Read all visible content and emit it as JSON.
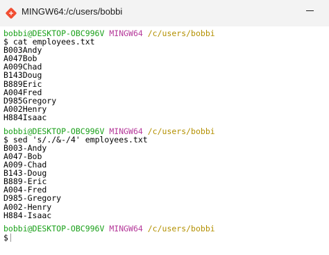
{
  "window": {
    "title": "MINGW64:/c/users/bobbi",
    "app_icon": "git-bash-icon"
  },
  "colors": {
    "user_host": "#1aa01a",
    "shell_name": "#b5399a",
    "cwd": "#b39000",
    "text": "#000000",
    "background": "#ffffff"
  },
  "prompt": {
    "user_host": "bobbi@DESKTOP-OBC996V",
    "shell": "MINGW64",
    "cwd": "/c/users/bobbi",
    "symbol": "$"
  },
  "blocks": [
    {
      "command": "cat employees.txt",
      "output": [
        "B003Andy",
        "A047Bob",
        "A009Chad",
        "B143Doug",
        "B889Eric",
        "A004Fred",
        "D985Gregory",
        "A002Henry",
        "H884Isaac"
      ]
    },
    {
      "command": "sed 's/./&-/4' employees.txt",
      "output": [
        "B003-Andy",
        "A047-Bob",
        "A009-Chad",
        "B143-Doug",
        "B889-Eric",
        "A004-Fred",
        "D985-Gregory",
        "A002-Henry",
        "H884-Isaac"
      ]
    }
  ]
}
